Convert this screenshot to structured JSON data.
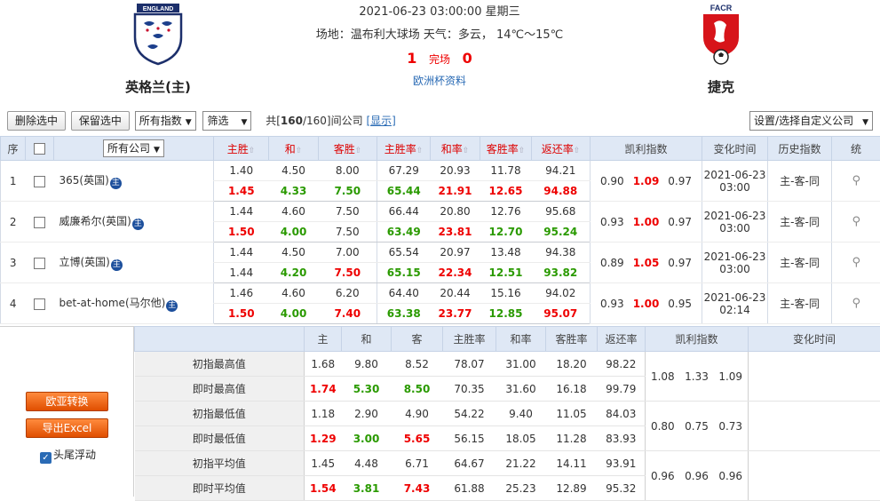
{
  "header": {
    "home_team": "英格兰(主)",
    "away_team": "捷克",
    "home_crest_text": "ENGLAND",
    "away_crest_text": "FACR",
    "datetime": "2021-06-23 03:00:00 星期三",
    "venue": "场地：温布利大球场 天气：多云， 14℃～15℃",
    "home_score": "1",
    "status": "完场",
    "away_score": "0",
    "euro_link": "欧洲杯资料"
  },
  "toolbar": {
    "delete_label": "删除选中",
    "keep_label": "保留选中",
    "index_select": "所有指数",
    "filter_label": "筛选",
    "count_prefix": "共[",
    "count_selected": "160",
    "count_suffix": "/160]间公司",
    "show_link": "[显示]",
    "custom_label": "设置/选择自定义公司"
  },
  "table": {
    "headers": {
      "seq": "序",
      "company": "所有公司",
      "home_win": "主胜",
      "draw": "和",
      "away_win": "客胜",
      "home_rate": "主胜率",
      "draw_rate": "和率",
      "away_rate": "客胜率",
      "return_rate": "返还率",
      "kelly": "凯利指数",
      "change_time": "变化时间",
      "history": "历史指数",
      "stats": "统"
    },
    "rows": [
      {
        "seq": "1",
        "company": "365(英国)",
        "init": [
          "1.40",
          "4.50",
          "8.00",
          "67.29",
          "20.93",
          "11.78",
          "94.21"
        ],
        "live": [
          "1.45",
          "4.33",
          "7.50",
          "65.44",
          "21.91",
          "12.65",
          "94.88"
        ],
        "kelly": [
          "0.90",
          "1.09",
          "0.97"
        ],
        "date": "2021-06-23",
        "time": "03:00",
        "history": "主-客-同"
      },
      {
        "seq": "2",
        "company": "威廉希尔(英国)",
        "init": [
          "1.44",
          "4.60",
          "7.50",
          "66.44",
          "20.80",
          "12.76",
          "95.68"
        ],
        "live": [
          "1.50",
          "4.00",
          "7.50",
          "63.49",
          "23.81",
          "12.70",
          "95.24"
        ],
        "kelly": [
          "0.93",
          "1.00",
          "0.97"
        ],
        "date": "2021-06-23",
        "time": "03:00",
        "history": "主-客-同"
      },
      {
        "seq": "3",
        "company": "立博(英国)",
        "init": [
          "1.44",
          "4.50",
          "7.00",
          "65.54",
          "20.97",
          "13.48",
          "94.38"
        ],
        "live": [
          "1.44",
          "4.20",
          "7.50",
          "65.15",
          "22.34",
          "12.51",
          "93.82"
        ],
        "kelly": [
          "0.89",
          "1.05",
          "0.97"
        ],
        "date": "2021-06-23",
        "time": "03:00",
        "history": "主-客-同"
      },
      {
        "seq": "4",
        "company": "bet-at-home(马尔他)",
        "init": [
          "1.46",
          "4.60",
          "6.20",
          "64.40",
          "20.44",
          "15.16",
          "94.02"
        ],
        "live": [
          "1.50",
          "4.00",
          "7.40",
          "63.38",
          "23.77",
          "12.85",
          "95.07"
        ],
        "kelly": [
          "0.93",
          "1.00",
          "0.95"
        ],
        "date": "2021-06-23",
        "time": "02:14",
        "history": "主-客-同"
      }
    ]
  },
  "summary": {
    "headers": [
      "主",
      "和",
      "客",
      "主胜率",
      "和率",
      "客胜率",
      "返还率",
      "凯利指数",
      "变化时间"
    ],
    "rows": [
      {
        "label": "初指最高值",
        "values": [
          "1.68",
          "9.80",
          "8.52",
          "78.07",
          "31.00",
          "18.20",
          "98.22"
        ]
      },
      {
        "label": "即时最高值",
        "values": [
          "1.74",
          "5.30",
          "8.50",
          "70.35",
          "31.60",
          "16.18",
          "99.79"
        ]
      },
      {
        "label": "初指最低值",
        "values": [
          "1.18",
          "2.90",
          "4.90",
          "54.22",
          "9.40",
          "11.05",
          "84.03"
        ]
      },
      {
        "label": "即时最低值",
        "values": [
          "1.29",
          "3.00",
          "5.65",
          "56.15",
          "18.05",
          "11.28",
          "83.93"
        ]
      },
      {
        "label": "初指平均值",
        "values": [
          "1.45",
          "4.48",
          "6.71",
          "64.67",
          "21.22",
          "14.11",
          "93.91"
        ]
      },
      {
        "label": "即时平均值",
        "values": [
          "1.54",
          "3.81",
          "7.43",
          "61.88",
          "25.23",
          "12.89",
          "95.32"
        ]
      }
    ],
    "kelly_high": [
      "1.08",
      "1.33",
      "1.09"
    ],
    "kelly_low": [
      "0.80",
      "0.75",
      "0.73"
    ],
    "kelly_avg": [
      "0.96",
      "0.96",
      "0.96"
    ]
  },
  "left_panel": {
    "convert_label": "欧亚转换",
    "export_label": "导出Excel",
    "float_label": "头尾浮动"
  },
  "colors": {
    "up": "#e00000",
    "down": "#2a9a00",
    "header_bg": "#dfe8f5",
    "accent": "#ff6a13"
  }
}
